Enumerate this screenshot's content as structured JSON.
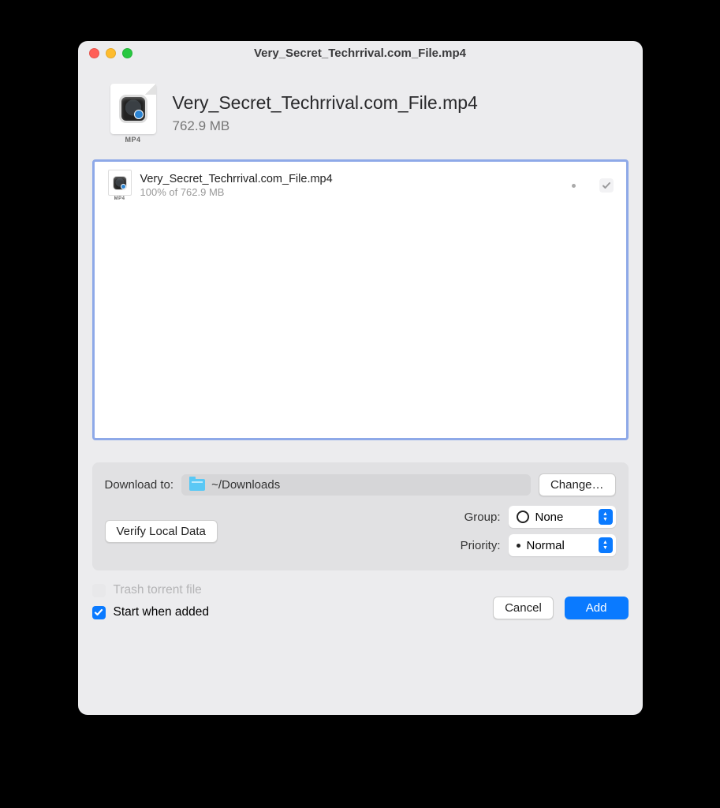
{
  "window": {
    "title": "Very_Secret_Techrrival.com_File.mp4"
  },
  "header": {
    "filename": "Very_Secret_Techrrival.com_File.mp4",
    "size": "762.9 MB",
    "filetype_badge": "MP4"
  },
  "files": [
    {
      "name": "Very_Secret_Techrrival.com_File.mp4",
      "status": "100% of 762.9 MB",
      "checked": true,
      "filetype_badge": "MP4"
    }
  ],
  "options": {
    "download_to_label": "Download to:",
    "download_path": "~/Downloads",
    "change_button": "Change…",
    "verify_button": "Verify Local Data",
    "group_label": "Group:",
    "group_value": "None",
    "priority_label": "Priority:",
    "priority_value": "Normal"
  },
  "checkboxes": {
    "trash_label": "Trash torrent file",
    "trash_checked": false,
    "trash_enabled": false,
    "start_label": "Start when added",
    "start_checked": true
  },
  "buttons": {
    "cancel": "Cancel",
    "add": "Add"
  }
}
